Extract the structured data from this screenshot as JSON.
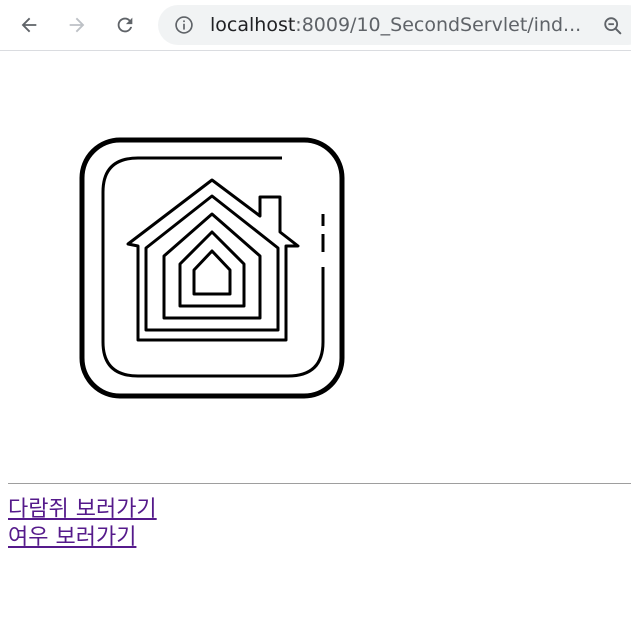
{
  "browser": {
    "url_host": "localhost",
    "url_rest": ":8009/10_SecondServlet/ind...",
    "icons": {
      "back": "back-arrow-icon",
      "forward": "forward-arrow-icon",
      "reload": "reload-icon",
      "info": "site-info-icon",
      "zoom": "zoom-out-icon"
    }
  },
  "page": {
    "logo": "home-app-icon",
    "links": [
      {
        "label": "다람쥐 보러가기"
      },
      {
        "label": "여우 보러가기"
      }
    ],
    "link_color": "#551a8b"
  }
}
